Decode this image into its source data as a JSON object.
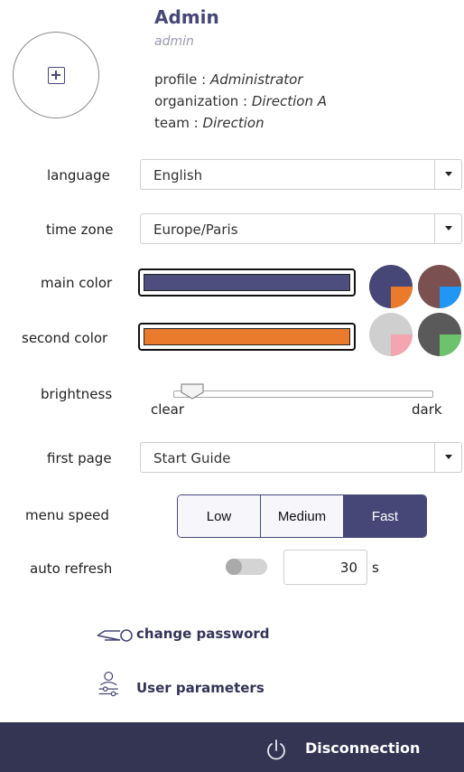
{
  "user": {
    "name": "Admin",
    "login": "admin",
    "profile_label": "profile : ",
    "profile": "Administrator",
    "organization_label": "organization : ",
    "organization": "Direction A",
    "team_label": "team : ",
    "team": "Direction"
  },
  "settings": {
    "language": {
      "label": "language",
      "value": "English"
    },
    "time_zone": {
      "label": "time zone",
      "value": "Europe/Paris"
    },
    "main_color": {
      "label": "main color",
      "value": "#4d4d7e"
    },
    "second_color": {
      "label": "second color",
      "value": "#ea7a2c"
    },
    "brightness": {
      "label": "brightness",
      "min_label": "clear",
      "max_label": "dark",
      "level": 0.03
    },
    "first_page": {
      "label": "first page",
      "value": "Start Guide"
    },
    "menu_speed": {
      "label": "menu speed",
      "options": [
        "Low",
        "Medium",
        "Fast"
      ],
      "selected": "Fast"
    },
    "auto_refresh": {
      "label": "auto refresh",
      "enabled": false,
      "value": "30",
      "unit": "s"
    }
  },
  "color_presets": [
    {
      "base": "#474777",
      "accent": "#ea7a2c"
    },
    {
      "base": "#7a5050",
      "accent": "#2196f3"
    },
    {
      "base": "#cfcfcf",
      "accent": "#f4a6b0"
    },
    {
      "base": "#5a5a5a",
      "accent": "#6cc36c"
    }
  ],
  "links": {
    "change_password": "change password",
    "user_parameters": "User parameters"
  },
  "footer": {
    "disconnect": "Disconnection"
  },
  "colors": {
    "accent": "#474777",
    "footer_bg": "#343453"
  },
  "icons": {
    "avatar": "plus-square-icon",
    "password": "key-icon",
    "parameters": "user-settings-icon",
    "disconnect": "power-icon"
  }
}
